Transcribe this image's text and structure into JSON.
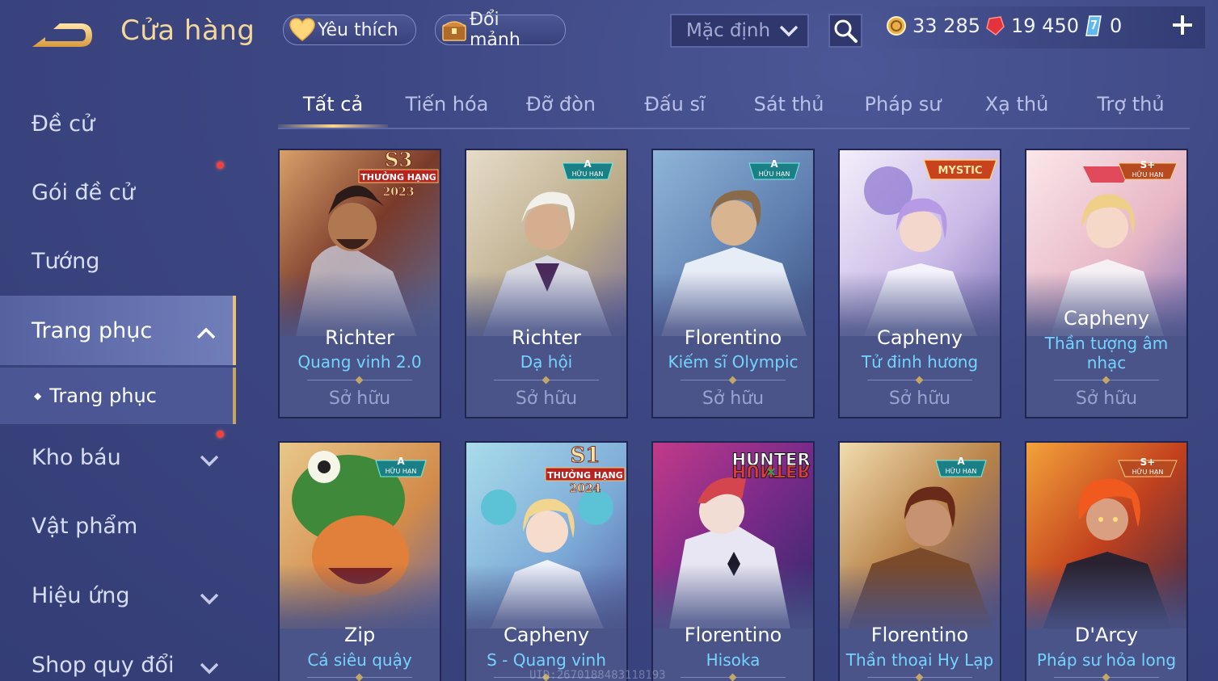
{
  "header": {
    "title": "Cửa hàng",
    "favorites_label": "Yêu thích",
    "shards_label": "Đổi mảnh",
    "sort": {
      "selected": "Mặc định"
    },
    "currency": {
      "gold": "33 285",
      "vouchers": "19 450",
      "crystals": "0"
    }
  },
  "sidebar": {
    "items": [
      {
        "label": "Đề cử"
      },
      {
        "label": "Gói đề cử"
      },
      {
        "label": "Tướng"
      },
      {
        "label": "Trang phục"
      },
      {
        "label": "Kho báu"
      },
      {
        "label": "Vật phẩm"
      },
      {
        "label": "Hiệu ứng"
      },
      {
        "label": "Shop quy đổi"
      }
    ],
    "sub_item": "Trang phục"
  },
  "tabs": [
    "Tất cả",
    "Tiến hóa",
    "Đỡ đòn",
    "Đấu sĩ",
    "Sát thủ",
    "Pháp sư",
    "Xạ thủ",
    "Trợ thủ"
  ],
  "cards": [
    {
      "hero": "Richter",
      "skin": "Quang vinh 2.0",
      "status": "Sở hữu",
      "badge": "S3 THƯỞNG HẠNG 2023"
    },
    {
      "hero": "Richter",
      "skin": "Dạ hội",
      "status": "Sở hữu",
      "badge": "A HỮU HẠN"
    },
    {
      "hero": "Florentino",
      "skin": "Kiếm sĩ Olympic",
      "status": "Sở hữu",
      "badge": "A HỮU HẠN"
    },
    {
      "hero": "Capheny",
      "skin": "Tử đinh hương",
      "status": "Sở hữu",
      "badge": "MYSTIC"
    },
    {
      "hero": "Capheny",
      "skin": "Thần tượng âm nhạc",
      "status": "Sở hữu",
      "badge": "S+ HỮU HẠN"
    },
    {
      "hero": "Zip",
      "skin": "Cá siêu quậy",
      "badge": "A HỮU HẠN"
    },
    {
      "hero": "Capheny",
      "skin": "S - Quang vinh",
      "badge": "S1 THƯỞNG HẠNG 2024"
    },
    {
      "hero": "Florentino",
      "skin": "Hisoka",
      "badge": "HUNTER×HUNTER"
    },
    {
      "hero": "Florentino",
      "skin": "Thần thoại Hy Lạp",
      "badge": "A HỮU HẠN"
    },
    {
      "hero": "D'Arcy",
      "skin": "Pháp sư hỏa long",
      "badge": "S+ HỮU HẠN"
    }
  ],
  "badge_text": {
    "tier_a": "A",
    "tier_splus": "S+",
    "limited": "HỮU HẠN",
    "mystic": "MYSTIC",
    "s3": "S3",
    "s1": "S1",
    "ranked": "THƯỞNG HẠNG",
    "year_2023": "2023",
    "year_2024": "2024",
    "hunter": "HUNTER",
    "hunter_mirror": "HUNTER"
  },
  "watermark": "UID:2670188483118193",
  "colors": {
    "accent_gold": "#f4d79a",
    "skin_name_blue": "#74d3ff",
    "notification_red": "#f2413c"
  }
}
